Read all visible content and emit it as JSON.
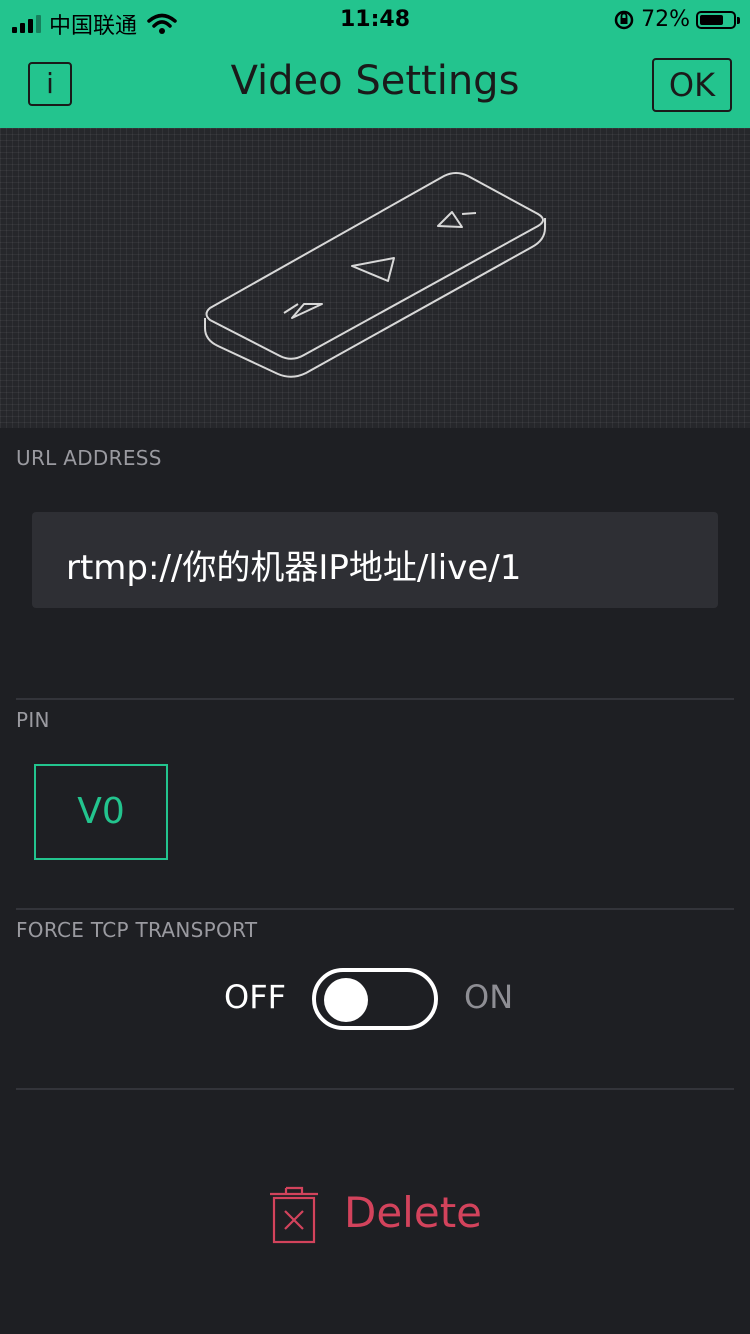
{
  "status_bar": {
    "carrier": "中国联通",
    "time": "11:48",
    "battery_percent": "72%",
    "battery_level": 0.72
  },
  "header": {
    "info_label": "i",
    "title": "Video Settings",
    "ok_label": "OK"
  },
  "url_section": {
    "label": "URL ADDRESS",
    "value": "rtmp://你的机器IP地址/live/1"
  },
  "pin_section": {
    "label": "PIN",
    "value": "V0"
  },
  "tcp_section": {
    "label": "FORCE TCP TRANSPORT",
    "off_label": "OFF",
    "on_label": "ON",
    "state": "off"
  },
  "delete": {
    "label": "Delete"
  },
  "icons": {
    "signal": "signal-icon",
    "wifi": "wifi-icon",
    "orientation_lock": "orientation-lock-icon",
    "battery": "battery-icon",
    "remote": "video-remote-illustration",
    "trash": "trash-icon"
  },
  "colors": {
    "accent": "#23c48e",
    "background": "#1e1f23",
    "danger": "#d3435c"
  }
}
